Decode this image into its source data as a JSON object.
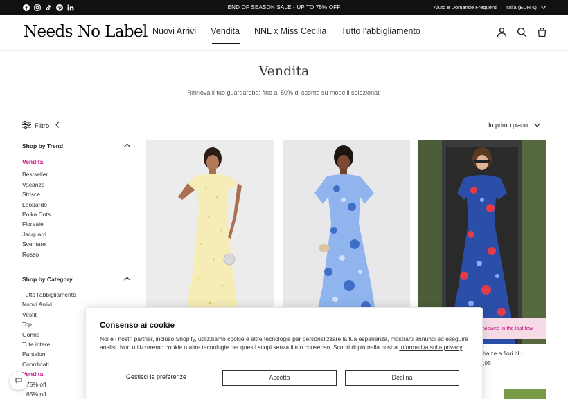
{
  "topbar": {
    "announcement": "END OF SEASON SALE - UP TO 75% OFF",
    "help_link": "Aiuto e Domande Frequenti",
    "currency": "Italia (EUR €)",
    "social_icons": [
      "facebook-icon",
      "instagram-icon",
      "tiktok-icon",
      "pinterest-icon",
      "linkedin-icon"
    ]
  },
  "header": {
    "logo": "Needs No Label",
    "nav": [
      "Nuovi Arrivi",
      "Vendita",
      "NNL x Miss Cecilia",
      "Tutto l'abbigliamento"
    ],
    "active_nav": "Vendita",
    "icons": [
      "account-icon",
      "search-icon",
      "cart-icon"
    ]
  },
  "page": {
    "title": "Vendita",
    "subtitle": "Rinnova il tuo guardaroba: fino al 50% di sconto su modelli selezionati"
  },
  "toolbar": {
    "filter_label": "Filtro",
    "sort_label": "In primo piano"
  },
  "sidebar": {
    "trend_heading": "Shop by Trend",
    "trend_items": [
      "Vendita",
      "Bestseller",
      "Vacanze",
      "Strisce",
      "Leopardo",
      "Polka Dots",
      "Floreale",
      "Jacquard",
      "Sventare",
      "Rosso"
    ],
    "category_heading": "Shop by Category",
    "category_items": [
      "Tutto l'abbigliamento",
      "Nuovi Arrivi",
      "Vestiti",
      "Top",
      "Gonne",
      "Tute intere",
      "Pantaloni",
      "Coordinati",
      "Vendita",
      "75% off",
      "65% off"
    ]
  },
  "products": [
    {
      "image": "yellow-dress-photo",
      "bg": "#ececec"
    },
    {
      "image": "blue-floral-dress-photo",
      "bg": "#e8e8ea"
    },
    {
      "image": "red-blue-floral-dress-photo",
      "bg": "#3b3b3c",
      "badge": "viewed in the last few",
      "name_fragment": "balze a fiori blu",
      "price_fragment": ",95"
    }
  ],
  "cookie": {
    "title": "Consenso ai cookie",
    "body": "Noi e i nostri partner, incluso Shopify, utilizziamo cookie e altre tecnologie per personalizzare la tua esperienza, mostrarti annunci ed eseguire analisi. Non utilizzeremo cookie o altre tecnologie per questi scopi senza il tuo consenso. Scopri di più nella nostra",
    "privacy_link": "Informativa sulla privacy",
    "manage": "Gestisci le preferenze",
    "accept": "Accetta",
    "decline": "Declina"
  },
  "colors": {
    "accent": "#c2127f",
    "badge_bg": "#f6dbe6",
    "topbar_bg": "#111111"
  }
}
